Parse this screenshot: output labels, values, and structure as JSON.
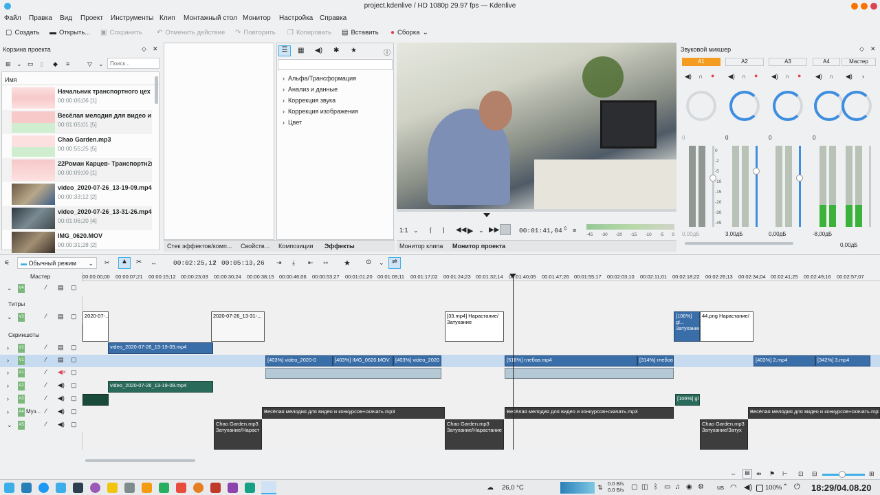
{
  "window": {
    "title": "project.kdenlive / HD 1080p 29.97 fps — Kdenlive"
  },
  "menu": [
    "Файл",
    "Правка",
    "Вид",
    "Проект",
    "Инструменты",
    "Клип",
    "Монтажный стол",
    "Монитор",
    "Настройка",
    "Справка"
  ],
  "toolbar": {
    "create": "Создать",
    "open": "Открыть...",
    "save": "Сохранить",
    "undo": "Отменить действие",
    "redo": "Повторить",
    "copy": "Копировать",
    "paste": "Вставить",
    "build": "Сборка"
  },
  "bin": {
    "title": "Корзина проекта",
    "search_placeholder": "Поиск...",
    "column": "Имя",
    "items": [
      {
        "name": "Начальник транспортного цех",
        "dur": "00:00:06;06 [1]"
      },
      {
        "name": "Весёлая мелодия для видео и",
        "dur": "00:01:05;01 [5]"
      },
      {
        "name": "Chao Garden.mp3",
        "dur": "00:00:55;25 [5]"
      },
      {
        "name": "22Роман Карцев- Транспортн2н",
        "dur": "00:00:09;00 [1]"
      },
      {
        "name": "video_2020-07-26_13-19-09.mp4",
        "dur": "00:00:33;12 [2]"
      },
      {
        "name": "video_2020-07-26_13-31-26.mp4",
        "dur": "00:01:06;20 [4]"
      },
      {
        "name": "IMG_0620.MOV",
        "dur": "00:00:31;28 [2]"
      }
    ]
  },
  "effects": {
    "categories": [
      "Альфа/Трансформация",
      "Анализ и данные",
      "Коррекция звука",
      "Коррекция изображения",
      "Цвет"
    ]
  },
  "tabs_left": [
    "Стек эффектов/комп...",
    "Свойств...",
    "Композиции",
    "Эффекты"
  ],
  "monitor": {
    "zoom": "1:1",
    "timecode": "00:01:41,04",
    "tab_clip": "Монитор клипа",
    "tab_project": "Монитор проекта",
    "audio_scale": [
      "-45",
      "-30",
      "-20",
      "-15",
      "-10",
      "-5",
      "0"
    ]
  },
  "mixer": {
    "title": "Звуковой микшер",
    "channels": [
      {
        "name": "A1",
        "gain": "0",
        "db": "0,00дБ",
        "active": true
      },
      {
        "name": "A2",
        "gain": "0",
        "db": "3,00дБ",
        "active": false
      },
      {
        "name": "A3",
        "gain": "0",
        "db": "0,00дБ",
        "active": false
      },
      {
        "name": "A4",
        "gain": "0",
        "db": "-8,00дБ",
        "active": false
      },
      {
        "name": "Мастер",
        "gain": "0",
        "db": "0,00дБ",
        "active": false
      }
    ],
    "scale": [
      "0",
      "-2",
      "-5",
      "-10",
      "-15",
      "-20",
      "-30",
      "-45"
    ]
  },
  "timeline_toolbar": {
    "mode": "Обычный режим",
    "position": "00:02:25,12",
    "duration": "00:05:13,26"
  },
  "ruler": [
    "00:00:00;00",
    "00:00:07;21",
    "00:00:15;12",
    "00:00:23;03",
    "00:00:30;24",
    "00:00:38;15",
    "00:00:46;06",
    "00:00:53;27",
    "00:01:01;20",
    "00:01:09;11",
    "00:01:17;02",
    "00:01:24;23",
    "00:01:32;14",
    "00:01:40;05",
    "00:01:47;26",
    "00:01:55;17",
    "00:02:03;10",
    "00:02:11;01",
    "00:02:18;22",
    "00:02:26;13",
    "00:02:34;04",
    "00:02:41;25",
    "00:02:49;16",
    "00:02:57;07"
  ],
  "tracks": {
    "master": "Мастер",
    "v4": "V4",
    "titles": "Титры",
    "v3": "V3",
    "screens": "Скриншоты",
    "v2": "V2",
    "v1": "V1",
    "a1": "A1",
    "a2": "A2",
    "a3": "A3",
    "a4": "A4",
    "a4name": "Муз...",
    "a5": "A5"
  },
  "clips": {
    "v3a": "2020-07-...",
    "v3b": "2020-07-26_13-31-...",
    "v3c": "[33.mp4] Нарастание/Затухание",
    "v3d": "[106%] gl... Затухание",
    "v3e": "44.png Нарастание/",
    "v2a": "video_2020-07-26_13-19-09.mp4",
    "v1a": "[403%] video_2020-0",
    "v1b": "[403%] IMG_0620.MOV",
    "v1c": "[403%] video_2020",
    "v1d": "[518%] глебов.mp4",
    "v1e": "[314%] глебов",
    "v1f": "[403%] 2.mp4",
    "v1g": "[342%] 3.mp4",
    "a2a": "video_2020-07-26_13-19-09.mp4",
    "a3a": "[106%] gl",
    "a4a": "Весёлая мелодия для видео и конкурсов+скачать.mp3",
    "a4b": "Весёлая мелодия для видео и конкурсов+скачать.mp3",
    "a4c": "Весёлая мелодия для видео и конкурсов+скачать.mp3",
    "a5a": "Chao Garden.mp3 Затухание/Нараст",
    "a5b": "Chao Garden.mp3 Затухание/Нарастание",
    "a5c": "Chao Garden.mp3 Затухание/Затух"
  },
  "taskbar": {
    "weather": "26,0 °C",
    "net_up": "0.0 B/s",
    "net_down": "0.0 B/s",
    "lang": "us",
    "battery": "100%",
    "clock": "18:29/04.08.20"
  },
  "colors": {
    "accent": "#3daee9",
    "active_channel": "#f39c1f",
    "clip_video": "#3a6ea8",
    "clip_audio": "#1a4a3a",
    "selected_track": "#c6daf0"
  }
}
